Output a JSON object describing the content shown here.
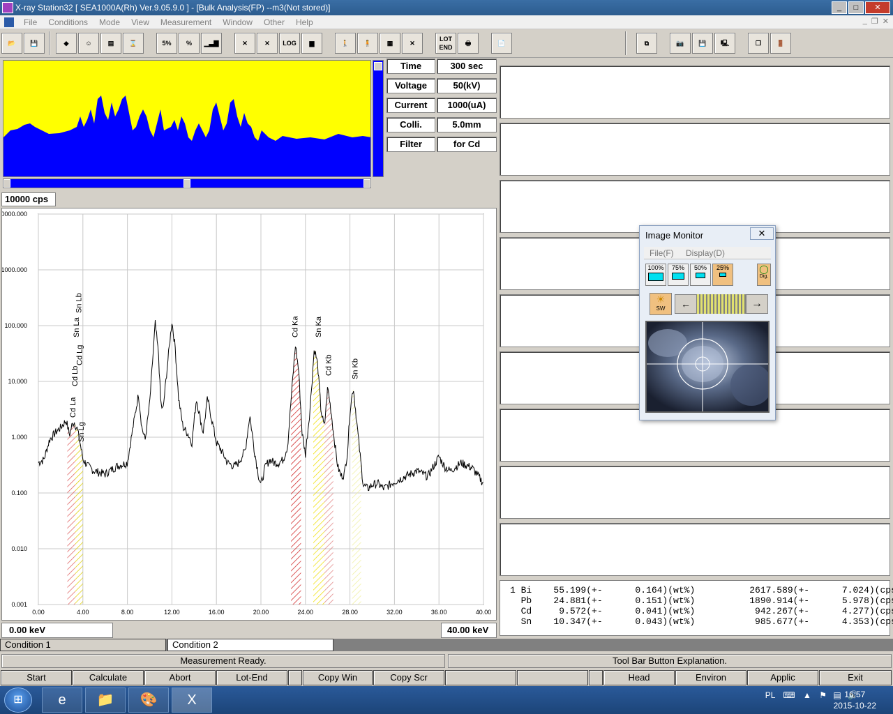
{
  "window": {
    "title": "X-ray Station32 [ SEA1000A(Rh) Ver.9.05.9.0 ] - [Bulk Analysis(FP)   --m3(Not stored)]"
  },
  "menu": [
    "File",
    "Conditions",
    "Mode",
    "View",
    "Measurement",
    "Window",
    "Other",
    "Help"
  ],
  "toolbar": {
    "pct5_label": "5%",
    "pct_label": "%",
    "log_label": "LOG",
    "lot_label": "LOT",
    "end_label": "END"
  },
  "conditions": [
    {
      "label": "Time",
      "value": "300 sec"
    },
    {
      "label": "Voltage",
      "value": "50(kV)"
    },
    {
      "label": "Current",
      "value": "1000(uA)"
    },
    {
      "label": "Colli.",
      "value": "5.0mm"
    },
    {
      "label": "Filter",
      "value": "for Cd"
    }
  ],
  "spectrum": {
    "cps_scale": "10000 cps",
    "kev_min_label": "0.00 keV",
    "kev_max_label": "40.00 keV"
  },
  "chart_data": {
    "type": "line",
    "xlabel": "",
    "ylabel": "",
    "xlim": [
      0,
      40
    ],
    "ylim_log": [
      0.001,
      10000
    ],
    "y_scale": "log",
    "x_ticks": [
      "0.00",
      "4.00",
      "8.00",
      "12.00",
      "16.00",
      "20.00",
      "24.00",
      "28.00",
      "32.00",
      "36.00",
      "40.00"
    ],
    "y_ticks": [
      "0000.000",
      "1000.000",
      "100.000",
      "10.000",
      "1.000",
      "0.100",
      "0.010",
      "0.001"
    ],
    "x": [
      0,
      0.5,
      1,
      1.5,
      2,
      2.5,
      2.8,
      3,
      3.2,
      3.5,
      3.8,
      4,
      4.5,
      5,
      6,
      7,
      8,
      8.5,
      9,
      9.3,
      9.6,
      10,
      10.5,
      10.8,
      11,
      11.2,
      11.6,
      12,
      12.3,
      12.6,
      13,
      13.4,
      13.8,
      14.2,
      14.8,
      15.2,
      15.6,
      16,
      16.4,
      17,
      17.6,
      18,
      18.6,
      19,
      19.4,
      19.8,
      20,
      20.4,
      20.8,
      21.2,
      21.6,
      22,
      22.4,
      22.8,
      23.1,
      23.4,
      23.7,
      24,
      24.4,
      24.8,
      25.1,
      25.4,
      25.7,
      26,
      26.3,
      26.6,
      26.9,
      27.2,
      27.5,
      27.8,
      28,
      28.3,
      28.6,
      28.9,
      29.2,
      29.6,
      30,
      30.5,
      31,
      32,
      33,
      34,
      35,
      35.5,
      36,
      36.5,
      37,
      38,
      39,
      40
    ],
    "series": [
      {
        "values": [
          0.35,
          0.4,
          0.9,
          1.2,
          1.5,
          2.0,
          1.1,
          1.6,
          1.9,
          1.4,
          0.7,
          0.4,
          0.3,
          0.25,
          0.22,
          0.3,
          0.35,
          1.5,
          6,
          1.5,
          0.9,
          4,
          110,
          30,
          4,
          3,
          20,
          120,
          40,
          5,
          1.5,
          1.2,
          0.8,
          5,
          1.2,
          5,
          2,
          0.8,
          0.6,
          0.35,
          0.3,
          0.35,
          0.6,
          2.5,
          0.6,
          0.2,
          0.14,
          0.3,
          0.4,
          0.35,
          0.35,
          0.4,
          0.7,
          8,
          45,
          15,
          1.2,
          0.5,
          3,
          40,
          20,
          3,
          1.5,
          8,
          3,
          0.9,
          0.3,
          0.2,
          0.22,
          0.6,
          3,
          8,
          2,
          0.5,
          0.14,
          0.12,
          0.14,
          0.15,
          0.12,
          0.16,
          0.2,
          0.25,
          0.2,
          0.3,
          0.45,
          0.3,
          0.25,
          0.35,
          0.28,
          0.15
        ]
      }
    ],
    "peak_labels": [
      {
        "text": "Cd La",
        "x": 3.13
      },
      {
        "text": "Sn Lg",
        "x": 3.9
      },
      {
        "text": "Cd Lb",
        "x": 3.32
      },
      {
        "text": "Cd Lg",
        "x": 3.72
      },
      {
        "text": "Sn La",
        "x": 3.44
      },
      {
        "text": "Sn Lb",
        "x": 3.66
      },
      {
        "text": "Cd Ka",
        "x": 23.1
      },
      {
        "text": "Sn Ka",
        "x": 25.2
      },
      {
        "text": "Cd Kb",
        "x": 26.1
      },
      {
        "text": "Sn Kb",
        "x": 28.5
      }
    ]
  },
  "results": [
    {
      "n": "1",
      "el": "Bi",
      "wt": "55.199",
      "wterr": "0.164",
      "cps": "2617.589",
      "cpserr": "7.024"
    },
    {
      "n": "",
      "el": "Pb",
      "wt": "24.881",
      "wterr": "0.151",
      "cps": "1890.914",
      "cpserr": "5.978"
    },
    {
      "n": "",
      "el": "Cd",
      "wt": "9.572",
      "wterr": "0.041",
      "cps": "942.267",
      "cpserr": "4.277"
    },
    {
      "n": "",
      "el": "Sn",
      "wt": "10.347",
      "wterr": "0.043",
      "cps": "985.677",
      "cpserr": "4.353"
    }
  ],
  "tabs": [
    "Condition 1",
    "Condition 2"
  ],
  "status": {
    "left": "Measurement Ready.",
    "right": "Tool Bar Button Explanation."
  },
  "buttons": [
    "Start",
    "Calculate",
    "Abort",
    "Lot-End",
    "Copy Win",
    "Copy Scr",
    "Head",
    "Environ",
    "Applic",
    "Exit"
  ],
  "image_monitor": {
    "title": "Image Monitor",
    "menu": [
      "File(F)",
      "Display(D)"
    ],
    "zooms": [
      "100%",
      "75%",
      "50%",
      "25%"
    ],
    "dig_label": "Dig.",
    "sw_label": "SW"
  },
  "taskbar": {
    "lang": "PL",
    "time": "16:57",
    "date": "2015-10-22"
  }
}
